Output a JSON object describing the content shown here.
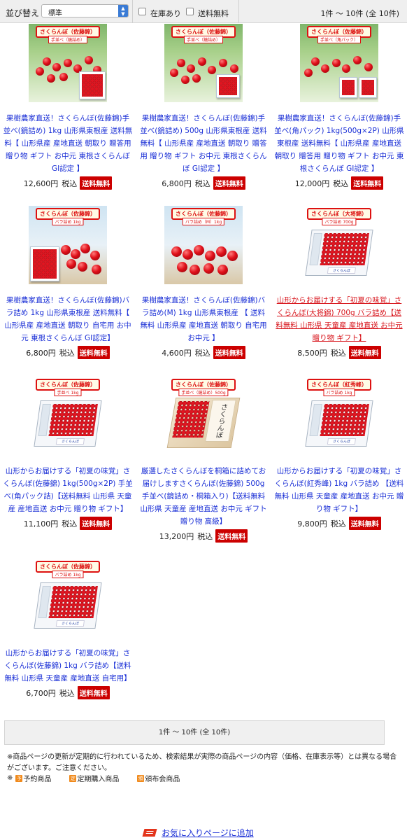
{
  "sortbar": {
    "label": "並び替え",
    "select_value": "標準",
    "instock_label": "在庫あり",
    "freeship_label": "送料無料",
    "count_text": "1件 〜 10件 (全 10件)"
  },
  "products": [
    {
      "name": "果樹農家直送！さくらんぼ(佐藤錦)手並べ(鏡詰め) 1kg 山形県東根産 送料無料【 山形県産 産地直送 朝取り 贈答用 贈り物 ギフト お中元 東根さくらんぼ GI認定 】",
      "price": "12,600円",
      "tax": "税込",
      "badge": "送料無料",
      "sign": "さくらんぼ（佐藤錦）",
      "sign_sub": "手並べ（鏡詰め）"
    },
    {
      "name": "果樹農家直送！さくらんぼ(佐藤錦)手並べ(鏡詰め) 500g 山形県東根産 送料無料【 山形県産 産地直送 朝取り 贈答用 贈り物 ギフト お中元 東根さくらんぼ GI認定 】",
      "price": "6,800円",
      "tax": "税込",
      "badge": "送料無料",
      "sign": "さくらんぼ（佐藤錦）",
      "sign_sub": "手並べ（鏡詰め）"
    },
    {
      "name": "果樹農家直送！さくらんぼ(佐藤錦)手並べ(角パック) 1kg(500g×2P) 山形県東根産 送料無料【 山形県産 産地直送 朝取り 贈答用 贈り物 ギフト お中元 東根さくらんぼ GI認定 】",
      "price": "12,000円",
      "tax": "税込",
      "badge": "送料無料",
      "sign": "さくらんぼ（佐藤錦）",
      "sign_sub": "手並べ（角パック）"
    },
    {
      "name": "果樹農家直送！さくらんぼ(佐藤錦)バラ詰め 1kg 山形県東根産 送料無料【 山形県産 産地直送 朝取り 自宅用 お中元 東根さくらんぼ GI認定】",
      "price": "6,800円",
      "tax": "税込",
      "badge": "送料無料",
      "sign": "さくらんぼ（佐藤錦）",
      "sign_sub": "バラ詰め 1kg"
    },
    {
      "name": "果樹農家直送！さくらんぼ(佐藤錦)バラ詰め(M) 1kg 山形県東根産 【 送料無料 山形県産 産地直送 朝取り 自宅用 お中元 】",
      "price": "4,600円",
      "tax": "税込",
      "badge": "送料無料",
      "sign": "さくらんぼ（佐藤錦）",
      "sign_sub": "バラ詰め（M）1kg"
    },
    {
      "name": "山形からお届けする「初夏の味覚」さくらんぼ(大将錦) 700g バラ詰め【送料無料 山形県 天童産 産地直送 お中元 贈り物 ギフト】",
      "price": "8,500円",
      "tax": "税込",
      "badge": "送料無料",
      "sign": "さくらんぼ（大将錦）",
      "sign_sub": "バラ詰め 700g"
    },
    {
      "name": "山形からお届けする「初夏の味覚」さくらんぼ(佐藤錦) 1kg(500g×2P) 手並べ(角パック詰)【送料無料 山形県 天童産 産地直送 お中元 贈り物 ギフト】",
      "price": "11,100円",
      "tax": "税込",
      "badge": "送料無料",
      "sign": "さくらんぼ（佐藤錦）",
      "sign_sub": "手並べ 1kg"
    },
    {
      "name": "厳選したさくらんぼを桐箱に詰めてお届けしますさくらんぼ(佐藤錦) 500g 手並べ(鏡詰め・桐箱入り)【送料無料 山形県 天童産 産地直送 お中元 ギフト 贈り物 高級】",
      "price": "13,200円",
      "tax": "税込",
      "badge": "送料無料",
      "sign": "さくらんぼ（佐藤錦）",
      "sign_sub": "手並べ（鏡詰め）500g"
    },
    {
      "name": "山形からお届けする「初夏の味覚」さくらんぼ(紅秀峰) 1kg バラ詰め 【送料無料 山形県 天童産 産地直送 お中元 贈り物 ギフト】",
      "price": "9,800円",
      "tax": "税込",
      "badge": "送料無料",
      "sign": "さくらんぼ（紅秀峰）",
      "sign_sub": "バラ詰め 1kg"
    },
    {
      "name": "山形からお届けする「初夏の味覚」さくらんぼ(佐藤錦) 1kg バラ詰め【送料無料 山形県 天童産 産地直送 自宅用】",
      "price": "6,700円",
      "tax": "税込",
      "badge": "送料無料",
      "sign": "さくらんぼ（佐藤錦）",
      "sign_sub": "バラ詰め 1kg"
    }
  ],
  "pager": {
    "text": "1件 〜 10件 (全 10件)"
  },
  "note": "※商品ページの更新が定期的に行われているため、検索結果が実際の商品ページの内容（価格、在庫表示等）とは異なる場合がございます。ご注意ください。",
  "legend": {
    "prefix": "※",
    "items": [
      {
        "icon": "予",
        "label": "予約商品"
      },
      {
        "icon": "定",
        "label": "定期購入商品"
      },
      {
        "icon": "頒",
        "label": "頒布会商品"
      }
    ]
  },
  "favorite_link": "お気に入りページに追加",
  "colors": {
    "link": "#1a2fd6",
    "link_visited": "#d8171e",
    "badge": "#cc0000",
    "select_arrow": "#3a7bd5"
  }
}
